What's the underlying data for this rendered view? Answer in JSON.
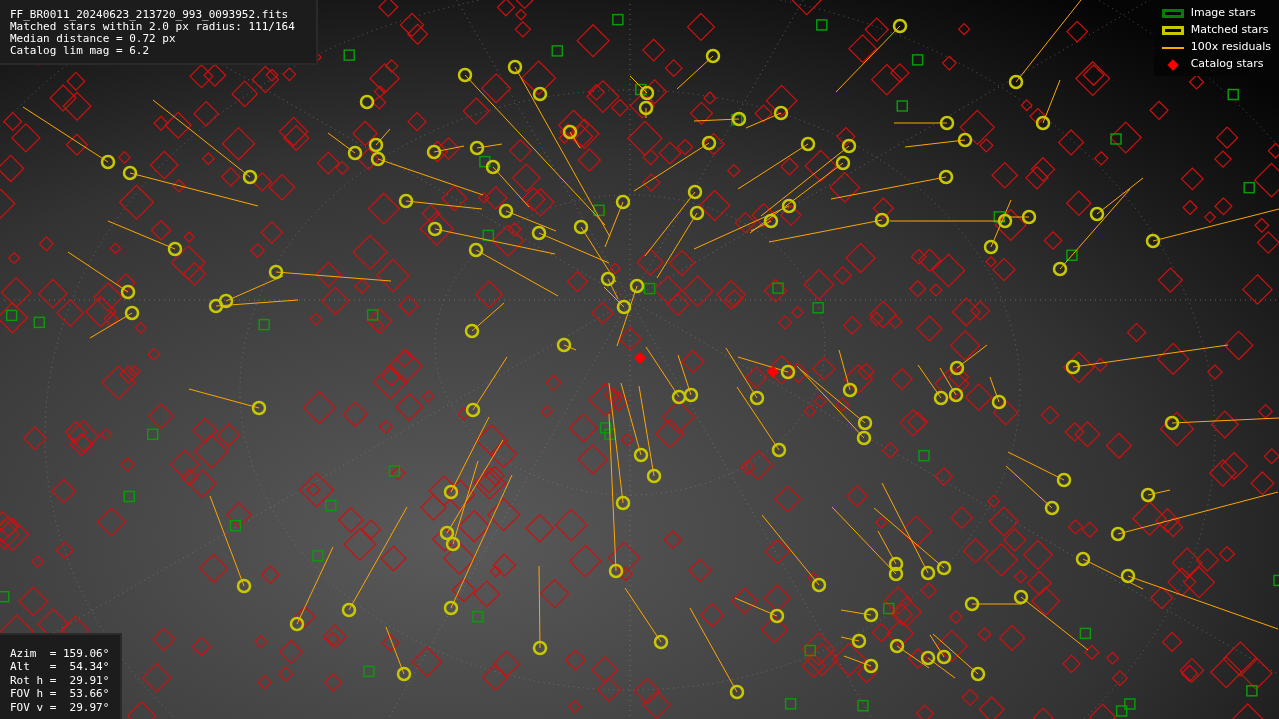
{
  "info_box": {
    "lines": [
      "FF_BR0011_20240623_213720_993_0093952.fits",
      "Matched stars within 2.0 px radius: 111/164",
      "Median distance = 0.72 px",
      "Catalog lim mag = 6.2"
    ]
  },
  "legend": [
    {
      "kind": "box",
      "label": "Image stars",
      "color": "#008000"
    },
    {
      "kind": "box",
      "label": "Matched stars",
      "color": "#c8c800"
    },
    {
      "kind": "line",
      "label": "100x residuals",
      "color": "#ffa500"
    },
    {
      "kind": "diamond",
      "label": "Catalog stars",
      "color": "#ff0000"
    }
  ],
  "pointing_box": {
    "lines": [
      "Azim  = 159.06°",
      "Alt   =  54.34°",
      "Rot h =  29.91°",
      "FOV h =  53.66°",
      "FOV v =  29.97°"
    ]
  }
}
